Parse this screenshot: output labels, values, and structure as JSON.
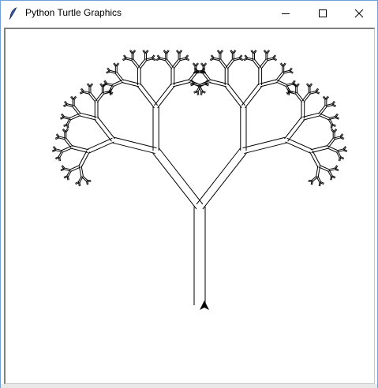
{
  "window": {
    "title": "Python Turtle Graphics",
    "app_icon": "feather-icon",
    "controls": {
      "minimize": "minimize-icon",
      "maximize": "maximize-icon",
      "close": "close-icon"
    },
    "border_color": "#6fa1d8"
  },
  "canvas": {
    "background": "#ffffff",
    "stroke_color": "#000000",
    "drawing": "fractal-tree",
    "turtle_shape": "arrow-cursor-icon"
  }
}
